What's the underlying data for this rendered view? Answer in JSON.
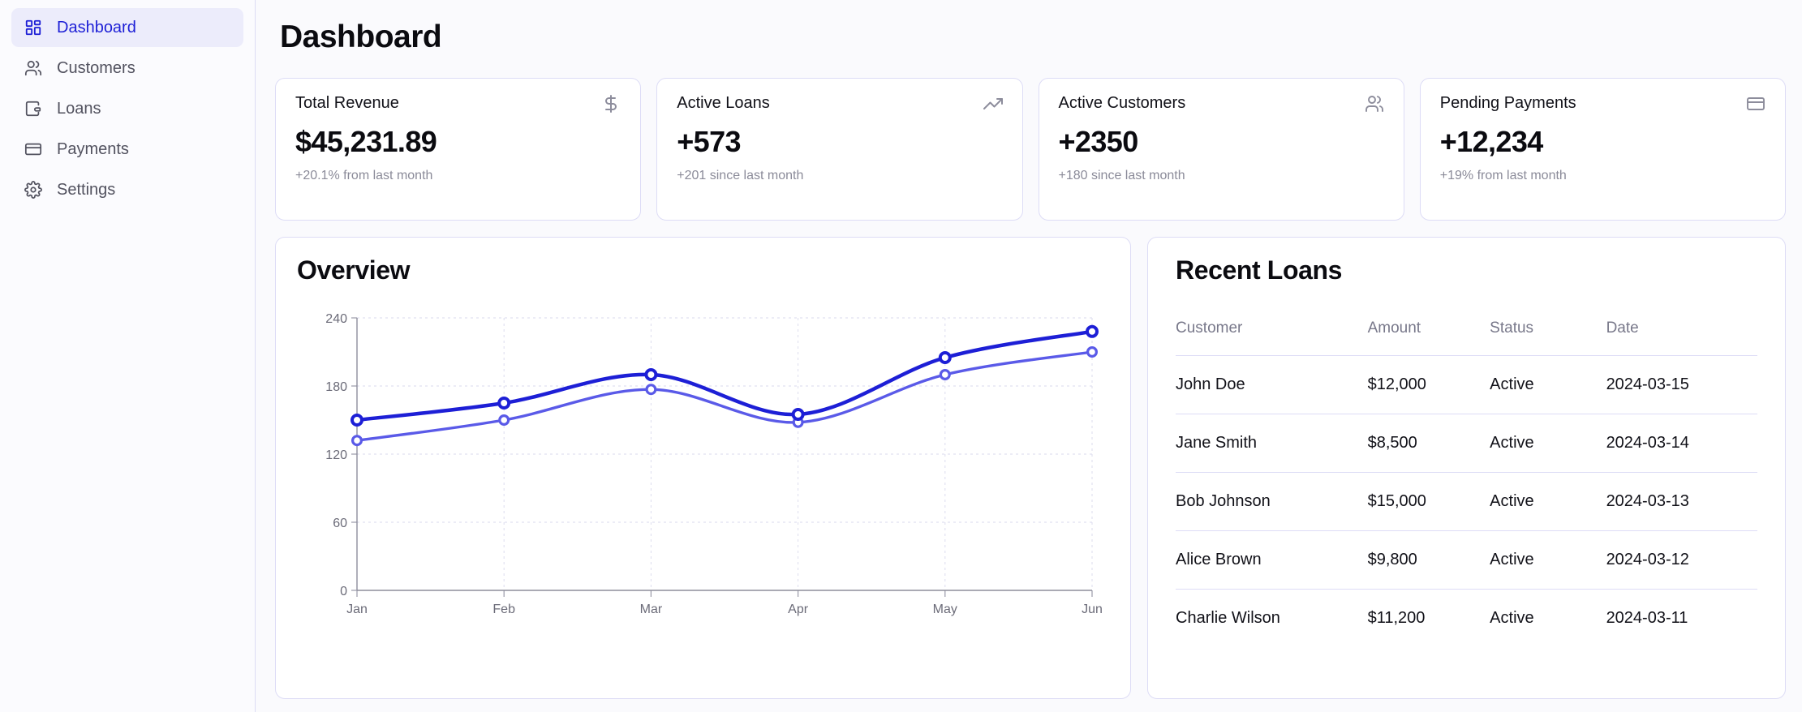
{
  "sidebar": {
    "items": [
      {
        "label": "Dashboard",
        "icon": "layout-dashboard-icon",
        "active": true
      },
      {
        "label": "Customers",
        "icon": "users-icon",
        "active": false
      },
      {
        "label": "Loans",
        "icon": "wallet-icon",
        "active": false
      },
      {
        "label": "Payments",
        "icon": "credit-card-icon",
        "active": false
      },
      {
        "label": "Settings",
        "icon": "gear-icon",
        "active": false
      }
    ]
  },
  "page": {
    "title": "Dashboard"
  },
  "stats": [
    {
      "title": "Total Revenue",
      "value": "$45,231.89",
      "sub": "+20.1% from last month",
      "icon": "dollar-sign-icon"
    },
    {
      "title": "Active Loans",
      "value": "+573",
      "sub": "+201 since last month",
      "icon": "trending-up-icon"
    },
    {
      "title": "Active Customers",
      "value": "+2350",
      "sub": "+180 since last month",
      "icon": "users-icon"
    },
    {
      "title": "Pending Payments",
      "value": "+12,234",
      "sub": "+19% from last month",
      "icon": "credit-card-icon"
    }
  ],
  "overview": {
    "title": "Overview"
  },
  "recent_loans": {
    "title": "Recent Loans",
    "columns": [
      "Customer",
      "Amount",
      "Status",
      "Date"
    ],
    "rows": [
      {
        "customer": "John Doe",
        "amount": "$12,000",
        "status": "Active",
        "date": "2024-03-15"
      },
      {
        "customer": "Jane Smith",
        "amount": "$8,500",
        "status": "Active",
        "date": "2024-03-14"
      },
      {
        "customer": "Bob Johnson",
        "amount": "$15,000",
        "status": "Active",
        "date": "2024-03-13"
      },
      {
        "customer": "Alice Brown",
        "amount": "$9,800",
        "status": "Active",
        "date": "2024-03-12"
      },
      {
        "customer": "Charlie Wilson",
        "amount": "$11,200",
        "status": "Active",
        "date": "2024-03-11"
      }
    ]
  },
  "colors": {
    "accent": "#1d1fd6",
    "series_primary": "#1d1fd6",
    "series_secondary": "#5a5ae8",
    "card_border": "#dddcf6",
    "sidebar_active_bg": "#ececfb",
    "muted_text": "#8b8b99"
  },
  "chart_data": {
    "type": "line",
    "title": "Overview",
    "categories": [
      "Jan",
      "Feb",
      "Mar",
      "Apr",
      "May",
      "Jun"
    ],
    "series": [
      {
        "name": "primary",
        "color": "#1d1fd6",
        "values": [
          150,
          165,
          190,
          155,
          205,
          228
        ]
      },
      {
        "name": "secondary",
        "color": "#5a5ae8",
        "values": [
          132,
          150,
          177,
          148,
          190,
          210
        ]
      }
    ],
    "xlabel": "",
    "ylabel": "",
    "ylim": [
      0,
      240
    ],
    "yticks": [
      0,
      60,
      120,
      180,
      240
    ],
    "grid": true,
    "legend": "none",
    "markers": true,
    "curve": "smooth"
  }
}
